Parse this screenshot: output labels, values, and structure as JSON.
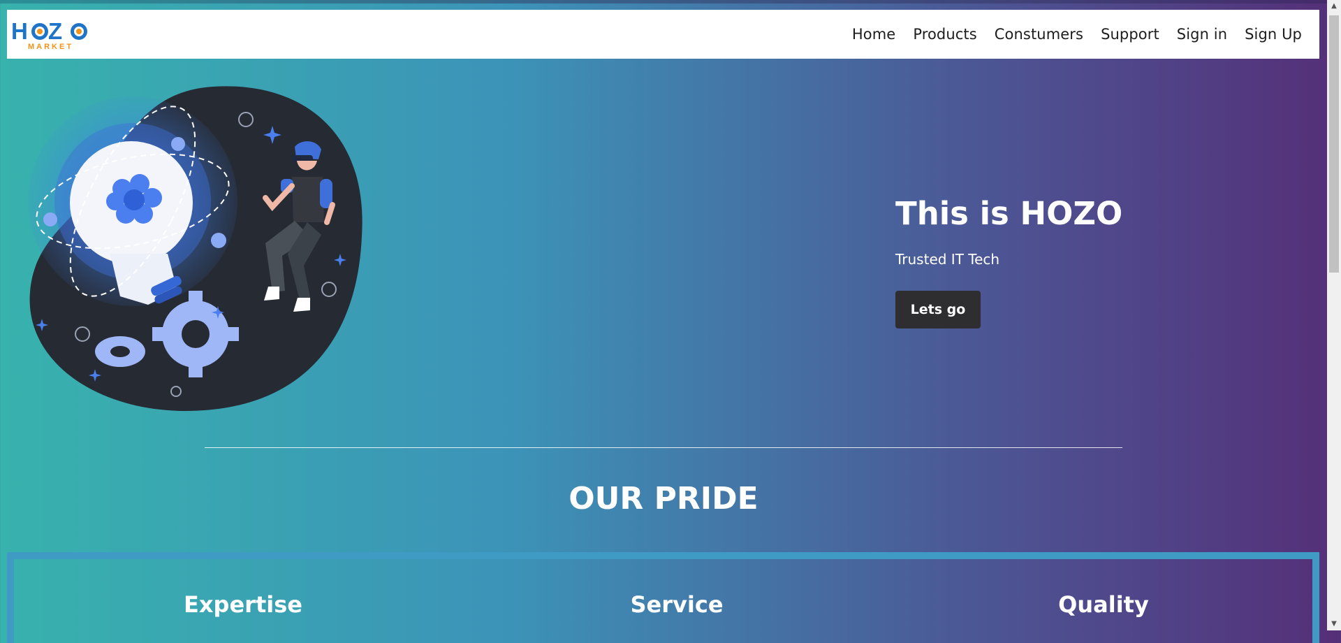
{
  "brand": {
    "logo_main": "HOZO",
    "logo_sub": "MARKET"
  },
  "nav": [
    "Home",
    "Products",
    "Constumers",
    "Support",
    "Sign in",
    "Sign Up"
  ],
  "hero": {
    "title": "This is HOZO",
    "subtitle": "Trusted IT Tech",
    "button": "Lets go"
  },
  "pride": {
    "title": "OUR PRIDE",
    "items": [
      "Expertise",
      "Service",
      "Quality"
    ]
  },
  "colors": {
    "accent_blue": "#1f74c8",
    "accent_orange": "#f39318",
    "button_dark": "#2e2e30"
  }
}
